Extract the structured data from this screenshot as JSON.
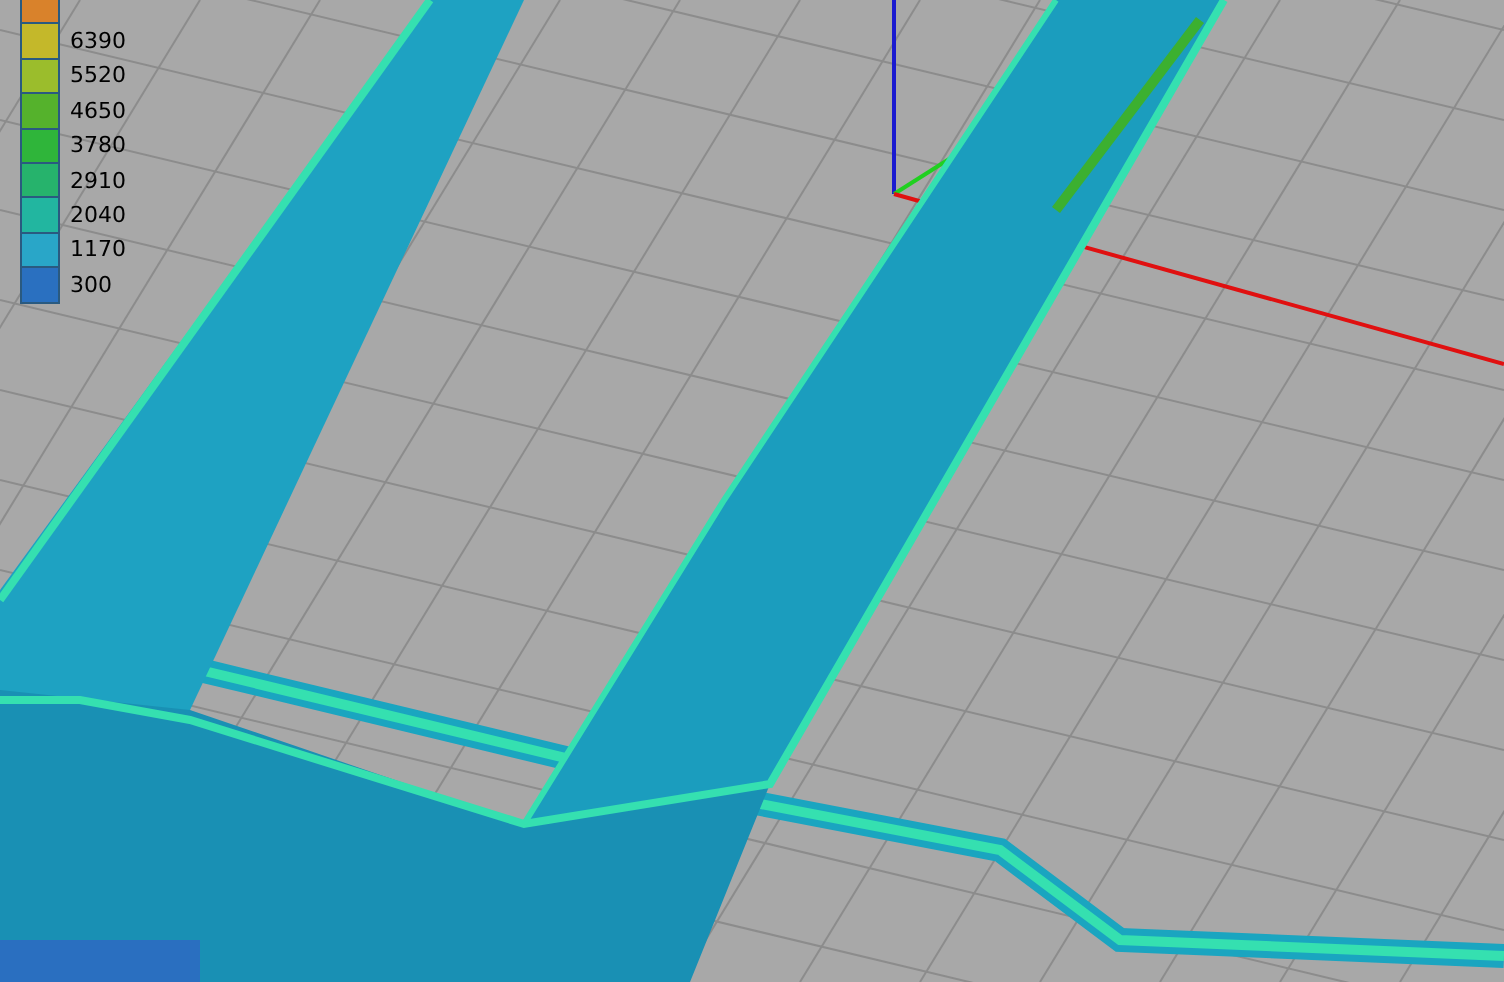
{
  "legend": {
    "items": [
      {
        "color": "#d9822b"
      },
      {
        "label": "6390",
        "color": "#c4b82a"
      },
      {
        "label": "5520",
        "color": "#9bbd2c"
      },
      {
        "label": "4650",
        "color": "#55b22c"
      },
      {
        "label": "3780",
        "color": "#2fb53a"
      },
      {
        "label": "2910",
        "color": "#26b36c"
      },
      {
        "label": "2040",
        "color": "#22b6a0"
      },
      {
        "label": "1170",
        "color": "#29a6c8"
      },
      {
        "label": "300",
        "color": "#2a70c0"
      }
    ]
  }
}
